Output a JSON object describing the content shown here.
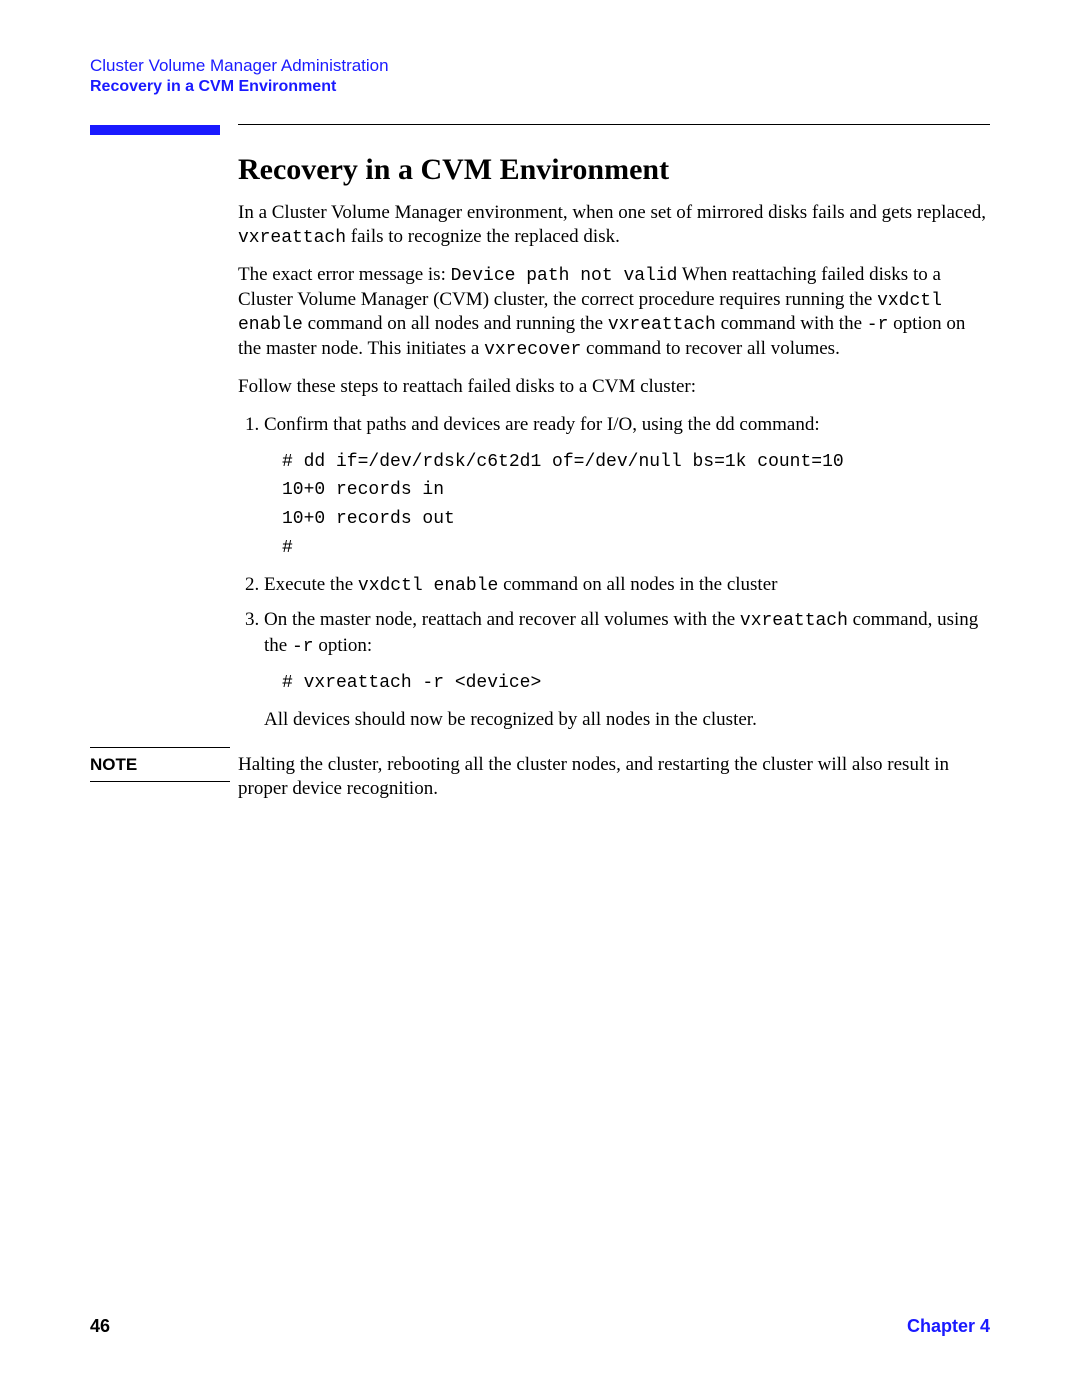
{
  "header": {
    "chapter_title": "Cluster Volume Manager Administration",
    "section_title": "Recovery in a CVM Environment"
  },
  "main": {
    "heading": "Recovery in a CVM Environment",
    "para1_a": "In a Cluster Volume Manager environment, when one set of mirrored disks fails and gets replaced, ",
    "para1_code": "vxreattach",
    "para1_b": " fails to recognize the replaced disk.",
    "para2_a": "The exact error message is: ",
    "para2_code1": "Device path not valid",
    "para2_b": " When reattaching failed disks to a Cluster Volume Manager (CVM) cluster, the correct procedure requires running the ",
    "para2_code2": "vxdctl enable",
    "para2_c": " command on all nodes and running the ",
    "para2_code3": "vxreattach",
    "para2_d": " command with the ",
    "para2_code4": "-r",
    "para2_e": "  option on the master node. This initiates a ",
    "para2_code5": "vxrecover",
    "para2_f": " command to recover all volumes.",
    "para3": "Follow these steps to reattach failed disks to a CVM cluster:",
    "steps": {
      "s1_text": "Confirm that paths and devices are ready for I/O, using the dd command:",
      "s1_code": "# dd if=/dev/rdsk/c6t2d1 of=/dev/null bs=1k count=10\n10+0 records in\n10+0 records out\n#",
      "s2_a": "Execute the ",
      "s2_code": "vxdctl enable",
      "s2_b": " command on all nodes in the cluster",
      "s3_a": "On the master node, reattach and recover all volumes with the ",
      "s3_code1": "vxreattach",
      "s3_b": " command, using the ",
      "s3_code2": "-r",
      "s3_c": " option:",
      "s3_cmd": "# vxreattach -r <device>",
      "s3_after": "All devices should now be recognized by all nodes in the cluster."
    },
    "note_label": "NOTE",
    "note_text": "Halting the cluster, rebooting all the cluster nodes, and restarting the cluster will also result in proper device recognition."
  },
  "footer": {
    "page_number": "46",
    "chapter_ref": "Chapter 4"
  }
}
